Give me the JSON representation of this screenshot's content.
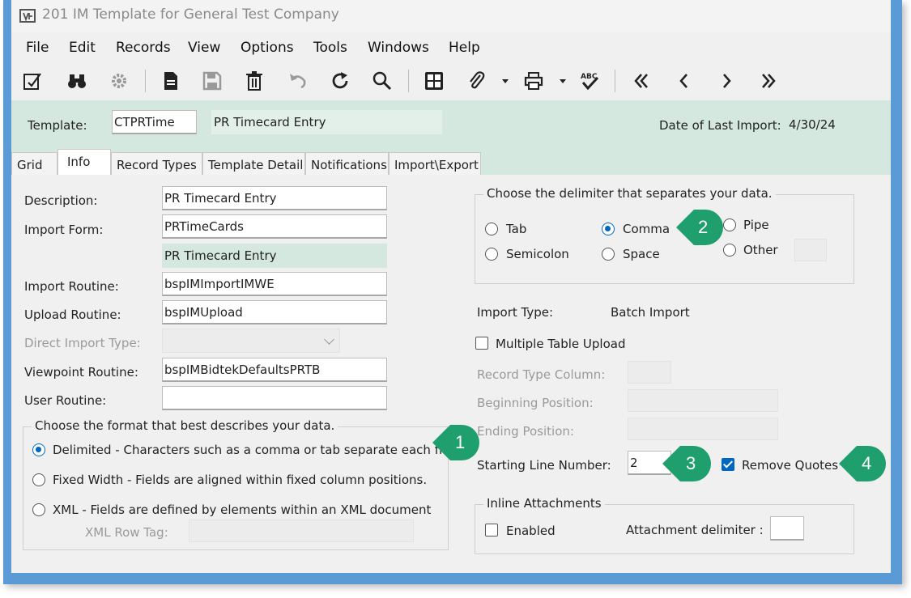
{
  "window": {
    "title": "201 IM Template for General Test Company"
  },
  "menu": [
    "File",
    "Edit",
    "Records",
    "View",
    "Options",
    "Tools",
    "Windows",
    "Help"
  ],
  "toolbar_icons": [
    "edit-form-icon",
    "binoculars-icon",
    "settings-gear-icon",
    "new-document-icon",
    "save-icon",
    "delete-icon",
    "undo-icon",
    "refresh-icon",
    "search-icon",
    "calculator-icon",
    "attachment-icon",
    "print-icon",
    "spellcheck-icon",
    "first-record-icon",
    "previous-record-icon",
    "next-record-icon",
    "last-record-icon"
  ],
  "header": {
    "template_label": "Template:",
    "template_value": "CTPRTime",
    "template_desc": "PR Timecard Entry",
    "last_import_label": "Date of Last Import:",
    "last_import_value": "4/30/24"
  },
  "tabs": [
    "Grid",
    "Info",
    "Record Types",
    "Template Detail",
    "Notifications",
    "Import\\Export"
  ],
  "info": {
    "description_label": "Description:",
    "description_value": "PR Timecard Entry",
    "import_form_label": "Import Form:",
    "import_form_value": "PRTimeCards",
    "import_form_desc": "PR Timecard Entry",
    "import_routine_label": "Import Routine:",
    "import_routine_value": "bspIMImportIMWE",
    "upload_routine_label": "Upload Routine:",
    "upload_routine_value": "bspIMUpload",
    "direct_import_label": "Direct Import Type:",
    "direct_import_value": "",
    "viewpoint_routine_label": "Viewpoint Routine:",
    "viewpoint_routine_value": "bspIMBidtekDefaultsPRTB",
    "user_routine_label": "User Routine:",
    "user_routine_value": ""
  },
  "format_group": {
    "legend": "Choose the format that best describes your data.",
    "options": [
      "Delimited - Characters such as a comma or tab separate each field.",
      "Fixed Width - Fields are aligned within fixed column positions.",
      "XML - Fields are defined by elements within an XML document"
    ],
    "selected": "Delimited - Characters such as a comma or tab separate each field.",
    "xml_row_tag_label": "XML Row Tag:",
    "xml_row_tag_value": ""
  },
  "delimiter_group": {
    "legend": "Choose the delimiter that separates your data.",
    "options": [
      "Tab",
      "Comma",
      "Pipe",
      "Semicolon",
      "Space",
      "Other"
    ],
    "selected": "Comma",
    "other_value": ""
  },
  "import_type_label": "Import Type:",
  "import_type_value": "Batch Import",
  "multiple_table_upload_label": "Multiple Table Upload",
  "multiple_table_upload_checked": false,
  "record_type_column_label": "Record Type Column:",
  "beginning_position_label": "Beginning Position:",
  "ending_position_label": "Ending Position:",
  "starting_line_label": "Starting Line Number:",
  "starting_line_value": "2",
  "remove_quotes_label": "Remove Quotes",
  "remove_quotes_checked": true,
  "inline_attachments": {
    "legend": "Inline Attachments",
    "enabled_label": "Enabled",
    "enabled_checked": false,
    "delimiter_label": "Attachment delimiter :",
    "delimiter_value": ""
  },
  "callouts": [
    "1",
    "2",
    "3",
    "4"
  ],
  "colors": {
    "accent": "#0067c0",
    "header_bg": "#d5e8df",
    "callout": "#1f9e6e",
    "frame": "#5b9bd5"
  }
}
